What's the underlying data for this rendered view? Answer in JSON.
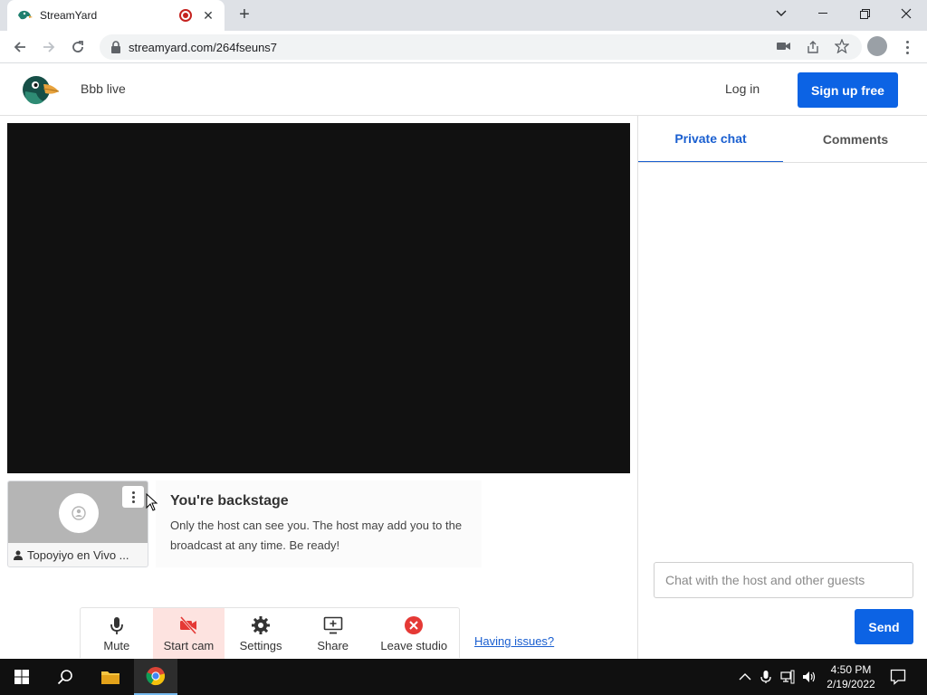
{
  "browser": {
    "tab_title": "StreamYard",
    "url": "streamyard.com/264fseuns7"
  },
  "header": {
    "studio_name": "Bbb live",
    "login_label": "Log in",
    "signup_label": "Sign up free"
  },
  "participant": {
    "name": "Topoyiyo en Vivo ..."
  },
  "backstage": {
    "title": "You're backstage",
    "message": "Only the host can see you. The host may add you to the broadcast at any time. Be ready!"
  },
  "controls": {
    "mute": "Mute",
    "start_cam": "Start cam",
    "settings": "Settings",
    "share": "Share",
    "leave": "Leave studio",
    "issues_link": "Having issues?"
  },
  "chat": {
    "tabs": [
      "Private chat",
      "Comments"
    ],
    "input_placeholder": "Chat with the host and other guests",
    "send_label": "Send"
  },
  "taskbar": {
    "time": "4:50 PM",
    "date": "2/19/2022"
  },
  "colors": {
    "brand_blue": "#0c63e4",
    "leave_red": "#e53935",
    "cam_off_bg": "#fde3e0"
  }
}
